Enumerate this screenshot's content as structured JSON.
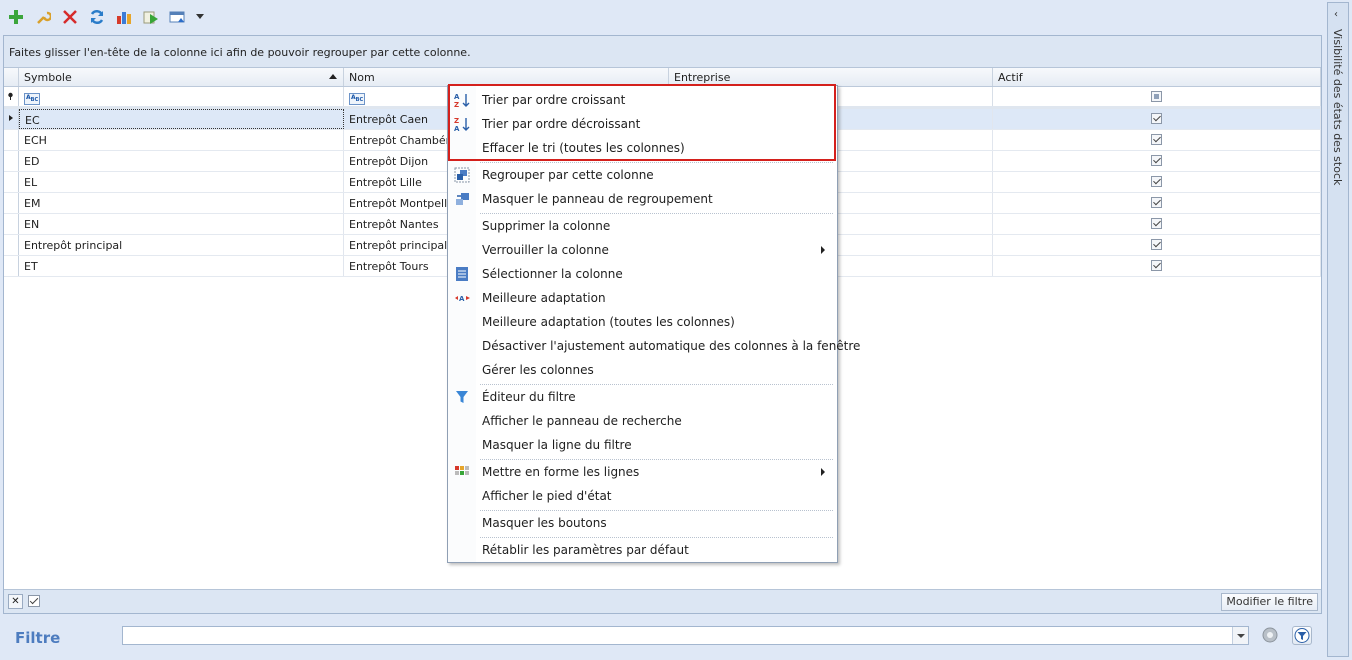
{
  "toolbar": {
    "buttons": [
      {
        "name": "add-icon"
      },
      {
        "name": "wrench-icon"
      },
      {
        "name": "delete-icon"
      },
      {
        "name": "refresh-icon"
      },
      {
        "name": "chart-icon"
      },
      {
        "name": "run-icon"
      },
      {
        "name": "export-icon"
      },
      {
        "name": "dropdown-icon"
      }
    ]
  },
  "grid": {
    "group_panel_text": "Faites glisser l'en-tête de la colonne ici afin de pouvoir regrouper par cette colonne.",
    "columns": {
      "symbole": "Symbole",
      "nom": "Nom",
      "entreprise": "Entreprise",
      "actif": "Actif"
    },
    "rows": [
      {
        "symbole": "EC",
        "nom": "Entrepôt Caen"
      },
      {
        "symbole": "ECH",
        "nom": "Entrepôt Chambéry"
      },
      {
        "symbole": "ED",
        "nom": "Entrepôt Dijon"
      },
      {
        "symbole": "EL",
        "nom": "Entrepôt Lille"
      },
      {
        "symbole": "EM",
        "nom": "Entrepôt Montpellier"
      },
      {
        "symbole": "EN",
        "nom": "Entrepôt Nantes"
      },
      {
        "symbole": "Entrepôt principal",
        "nom": "Entrepôt principal"
      },
      {
        "symbole": "ET",
        "nom": "Entrepôt Tours"
      }
    ],
    "footer": {
      "close_glyph": "✕",
      "modify_filter": "Modifier le filtre"
    }
  },
  "bottom": {
    "filter_label": "Filtre",
    "filter_value": ""
  },
  "side_panel": {
    "label": "Visibilité des états des stock",
    "chevron": "‹"
  },
  "context_menu": {
    "items": [
      {
        "label": "Trier par ordre croissant",
        "icon": "sort-ascending-icon"
      },
      {
        "label": "Trier par ordre décroissant",
        "icon": "sort-descending-icon"
      },
      {
        "label": "Effacer le tri (toutes les colonnes)",
        "icon": ""
      },
      {
        "label": "Regrouper par cette colonne",
        "icon": "group-column-icon"
      },
      {
        "label": "Masquer le panneau de regroupement",
        "icon": "group-panel-icon"
      },
      {
        "label": "Supprimer la colonne",
        "icon": ""
      },
      {
        "label": "Verrouiller la colonne",
        "icon": "",
        "submenu": true
      },
      {
        "label": "Sélectionner la colonne",
        "icon": "select-column-icon"
      },
      {
        "label": "Meilleure adaptation",
        "icon": "best-fit-icon"
      },
      {
        "label": "Meilleure adaptation (toutes les colonnes)",
        "icon": ""
      },
      {
        "label": "Désactiver l'ajustement automatique des colonnes à la fenêtre",
        "icon": ""
      },
      {
        "label": "Gérer les colonnes",
        "icon": ""
      },
      {
        "label": "Éditeur du filtre",
        "icon": "filter-icon"
      },
      {
        "label": "Afficher le panneau de recherche",
        "icon": ""
      },
      {
        "label": "Masquer la ligne du filtre",
        "icon": ""
      },
      {
        "label": "Mettre en forme les lignes",
        "icon": "format-rows-icon",
        "submenu": true
      },
      {
        "label": "Afficher le pied d'état",
        "icon": ""
      },
      {
        "label": "Masquer les boutons",
        "icon": ""
      },
      {
        "label": "Rétablir les paramètres par défaut",
        "icon": ""
      }
    ]
  },
  "colors": {
    "highlight_border": "#d4201c",
    "filter_label": "#4d7cbf",
    "panel_bg": "#dfe8f6"
  }
}
